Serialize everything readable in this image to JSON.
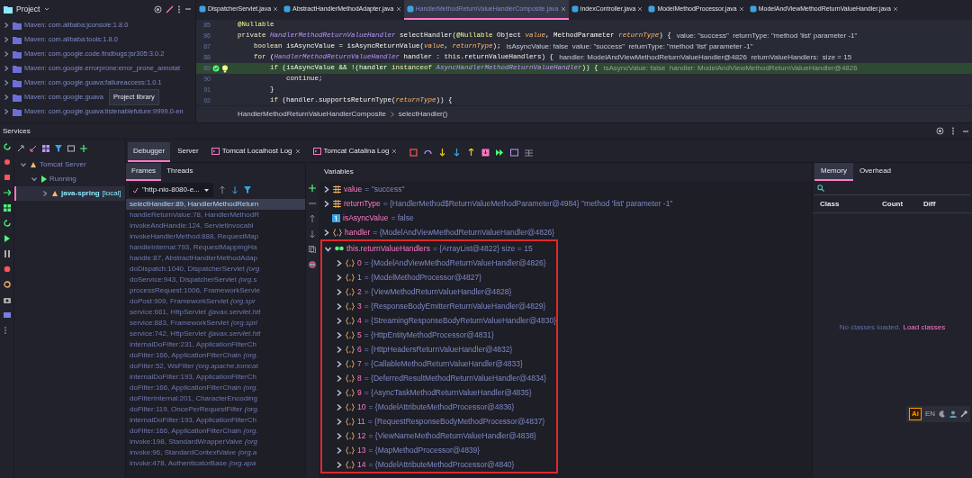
{
  "project": {
    "title": "Project",
    "items": [
      {
        "label": "Maven: com.alibaba:jconsole:1.8.0",
        "expanded": false
      },
      {
        "label": "Maven: com.alibaba:tools:1.8.0",
        "expanded": false
      },
      {
        "label": "Maven: com.google.code.findbugs:jsr305:3.0.2",
        "expanded": false
      },
      {
        "label": "Maven: com.google.errorprone:error_prone_annotat",
        "expanded": false
      },
      {
        "label": "Maven: com.google.guava:failureaccess:1.0.1",
        "expanded": false
      },
      {
        "label": "Maven: com.google.guava",
        "expanded": false,
        "tooltip": "Project library"
      },
      {
        "label": "Maven: com.google.guava:listenablefuture:9999.0-en",
        "expanded": false
      }
    ]
  },
  "editor": {
    "tabs": [
      {
        "label": "DispatcherServlet.java",
        "selected": false
      },
      {
        "label": "AbstractHandlerMethodAdapter.java",
        "selected": false
      },
      {
        "label": "HandlerMethodReturnValueHandlerComposite.java",
        "selected": true
      },
      {
        "label": "IndexController.java",
        "selected": false
      },
      {
        "label": "ModelMethodProcessor.java",
        "selected": false
      },
      {
        "label": "ModelAndViewMethodReturnValueHandler.java",
        "selected": false
      }
    ],
    "lines": [
      {
        "number": "85",
        "current": false,
        "breakpoint": false,
        "tokens": [
          {
            "kind": "annotation",
            "text": "@Nullable"
          }
        ]
      },
      {
        "number": "86",
        "current": false,
        "breakpoint": false,
        "tokens": [
          {
            "kind": "keyword",
            "text": "private "
          },
          {
            "kind": "type",
            "text": "HandlerMethodReturnValueHandler"
          },
          {
            "kind": "plain",
            "text": " selectHandler("
          },
          {
            "kind": "annotation",
            "text": "@Nullable"
          },
          {
            "kind": "plain",
            "text": " Object "
          },
          {
            "kind": "param",
            "text": "value"
          },
          {
            "kind": "plain",
            "text": ", MethodParameter "
          },
          {
            "kind": "param",
            "text": "returnType"
          },
          {
            "kind": "plain",
            "text": ") {"
          }
        ],
        "hint": "value: \"success\"  returnType: \"method 'list' parameter -1\""
      },
      {
        "number": "87",
        "current": false,
        "breakpoint": false,
        "tokens": [
          {
            "kind": "keyword",
            "text": "    boolean "
          },
          {
            "kind": "plain",
            "text": "isAsyncValue = isAsyncReturnValue("
          },
          {
            "kind": "param",
            "text": "value"
          },
          {
            "kind": "plain",
            "text": ", "
          },
          {
            "kind": "param",
            "text": "returnType"
          },
          {
            "kind": "plain",
            "text": ");"
          }
        ],
        "hint": "isAsyncValue: false  value: \"success\"  returnType: \"method 'list' parameter -1\""
      },
      {
        "number": "88",
        "current": false,
        "breakpoint": false,
        "tokens": [
          {
            "kind": "keyword",
            "text": "    for "
          },
          {
            "kind": "plain",
            "text": "("
          },
          {
            "kind": "type",
            "text": "HandlerMethodReturnValueHandler"
          },
          {
            "kind": "plain",
            "text": " handler : "
          },
          {
            "kind": "keyword",
            "text": "this"
          },
          {
            "kind": "plain",
            "text": ".returnValueHandlers) {"
          }
        ],
        "hint": "handler: ModelAndViewMethodReturnValueHandler@4826  returnValueHandlers:  size = 15"
      },
      {
        "number": "89",
        "current": true,
        "breakpoint": true,
        "tokens": [
          {
            "kind": "keyword",
            "text": "        if "
          },
          {
            "kind": "plain",
            "text": "(isAsyncValue && !(handler "
          },
          {
            "kind": "keyword",
            "text": "instanceof "
          },
          {
            "kind": "type",
            "text": "AsyncHandlerMethodReturnValueHandler"
          },
          {
            "kind": "plain",
            "text": ")) {"
          }
        ],
        "hint": "isAsyncValue: false  handler: ModelAndViewMethodReturnValueHandler@4826"
      },
      {
        "number": "90",
        "current": false,
        "breakpoint": false,
        "tokens": [
          {
            "kind": "keyword",
            "text": "            continue"
          },
          {
            "kind": "plain",
            "text": ";"
          }
        ]
      },
      {
        "number": "91",
        "current": false,
        "breakpoint": false,
        "tokens": [
          {
            "kind": "plain",
            "text": "        }"
          }
        ]
      },
      {
        "number": "92",
        "current": false,
        "breakpoint": false,
        "tokens": [
          {
            "kind": "keyword",
            "text": "        if "
          },
          {
            "kind": "plain",
            "text": "(handler.supportsReturnType("
          },
          {
            "kind": "param",
            "text": "returnType"
          },
          {
            "kind": "plain",
            "text": ")) {"
          }
        ]
      }
    ],
    "breadcrumb": [
      "HandlerMethodReturnValueHandlerComposite",
      "selectHandler()"
    ]
  },
  "services": {
    "title": "Services",
    "tree": [
      {
        "label": "Tomcat Server",
        "expanded": true,
        "selected": false,
        "children": [
          {
            "label": "Running",
            "expanded": true,
            "selected": false,
            "children": [
              {
                "label": "java-spring",
                "suffix": "[local]",
                "expanded": false,
                "selected": true
              }
            ]
          }
        ]
      }
    ]
  },
  "debugger": {
    "tabs": [
      {
        "label": "Debugger",
        "kind": "plain",
        "selected": true
      },
      {
        "label": "Server",
        "kind": "plain",
        "selected": false
      },
      {
        "label": "Tomcat Localhost Log",
        "kind": "log",
        "selected": false
      },
      {
        "label": "Tomcat Catalina Log",
        "kind": "log",
        "selected": false
      }
    ],
    "frame_tabs": [
      {
        "label": "Frames",
        "selected": true
      },
      {
        "label": "Threads",
        "selected": false
      }
    ],
    "thread": "\"http-nio-8080-e...",
    "frames": [
      {
        "text": "selectHandler:89, HandlerMethodReturn",
        "selected": true
      },
      {
        "text": "handleReturnValue:78, HandlerMethodR",
        "selected": false
      },
      {
        "text": "invokeAndHandle:124, ServletInvocabl",
        "selected": false
      },
      {
        "text": "invokeHandlerMethod:888, RequestMap",
        "selected": false
      },
      {
        "text": "handleInternal:793, RequestMappingHa",
        "selected": false
      },
      {
        "text": "handle:87, AbstractHandlerMethodAdap",
        "selected": false
      },
      {
        "text": "doDispatch:1040, DispatcherServlet *(org*",
        "selected": false
      },
      {
        "text": "doService:943, DispatcherServlet *(org.s*",
        "selected": false
      },
      {
        "text": "processRequest:1006, FrameworkServle",
        "selected": false
      },
      {
        "text": "doPost:909, FrameworkServlet *(org.spr*",
        "selected": false
      },
      {
        "text": "service:661, HttpServlet *(javax.servlet.htt*",
        "selected": false
      },
      {
        "text": "service:883, FrameworkServlet *(org.spri*",
        "selected": false
      },
      {
        "text": "service:742, HttpServlet *(javax.servlet.htt*",
        "selected": false
      },
      {
        "text": "internalDoFilter:231, ApplicationFilterCh",
        "selected": false
      },
      {
        "text": "doFilter:166, ApplicationFilterChain *(org.*",
        "selected": false
      },
      {
        "text": "doFilter:52, WsFilter *(org.apache.tomcat*",
        "selected": false
      },
      {
        "text": "internalDoFilter:193, ApplicationFilterCh",
        "selected": false
      },
      {
        "text": "doFilter:166, ApplicationFilterChain *(org.*",
        "selected": false
      },
      {
        "text": "doFilterInternal:201, CharacterEncoding",
        "selected": false
      },
      {
        "text": "doFilter:119, OncePerRequestFilter *(org.*",
        "selected": false
      },
      {
        "text": "internalDoFilter:193, ApplicationFilterCh",
        "selected": false
      },
      {
        "text": "doFilter:166, ApplicationFilterChain *(org.*",
        "selected": false
      },
      {
        "text": "invoke:198, StandardWrapperValve *(org*",
        "selected": false
      },
      {
        "text": "invoke:96, StandardContextValve *(org.a*",
        "selected": false
      },
      {
        "text": "invoke:478, AuthenticatorBase *(org.apa*",
        "selected": false
      }
    ],
    "variables_title": "Variables",
    "variables": [
      {
        "kind": "field",
        "name": "value",
        "value": "= \"success\"",
        "expanded": false,
        "highlighted": false
      },
      {
        "kind": "field",
        "name": "returnType",
        "value": "= {HandlerMethod$ReturnValueMethodParameter@4984} \"method 'list' parameter -1\"",
        "expanded": false,
        "highlighted": false
      },
      {
        "kind": "primitive",
        "name": "isAsyncValue",
        "value": "= false",
        "highlighted": false
      },
      {
        "kind": "object",
        "name": "handler",
        "value": "= {ModelAndViewMethodReturnValueHandler@4826}",
        "expanded": false,
        "highlighted": false
      },
      {
        "kind": "watch",
        "name": "this.returnValueHandlers",
        "value": "= {ArrayList@4822}  size = 15",
        "expanded": true,
        "highlighted": true,
        "children": [
          {
            "kind": "object",
            "name": "0",
            "value": "= {ModelAndViewMethodReturnValueHandler@4826}",
            "expanded": false
          },
          {
            "kind": "object",
            "name": "1",
            "value": "= {ModelMethodProcessor@4827}",
            "expanded": false
          },
          {
            "kind": "object",
            "name": "2",
            "value": "= {ViewMethodReturnValueHandler@4828}",
            "expanded": false
          },
          {
            "kind": "object",
            "name": "3",
            "value": "= {ResponseBodyEmitterReturnValueHandler@4829}",
            "expanded": false
          },
          {
            "kind": "object",
            "name": "4",
            "value": "= {StreamingResponseBodyReturnValueHandler@4830}",
            "expanded": false
          },
          {
            "kind": "object",
            "name": "5",
            "value": "= {HttpEntityMethodProcessor@4831}",
            "expanded": false
          },
          {
            "kind": "object",
            "name": "6",
            "value": "= {HttpHeadersReturnValueHandler@4832}",
            "expanded": false
          },
          {
            "kind": "object",
            "name": "7",
            "value": "= {CallableMethodReturnValueHandler@4833}",
            "expanded": false
          },
          {
            "kind": "object",
            "name": "8",
            "value": "= {DeferredResultMethodReturnValueHandler@4834}",
            "expanded": false
          },
          {
            "kind": "object",
            "name": "9",
            "value": "= {AsyncTaskMethodReturnValueHandler@4835}",
            "expanded": false
          },
          {
            "kind": "object",
            "name": "10",
            "value": "= {ModelAttributeMethodProcessor@4836}",
            "expanded": false
          },
          {
            "kind": "object",
            "name": "11",
            "value": "= {RequestResponseBodyMethodProcessor@4837}",
            "expanded": false
          },
          {
            "kind": "object",
            "name": "12",
            "value": "= {ViewNameMethodReturnValueHandler@4838}",
            "expanded": false
          },
          {
            "kind": "object",
            "name": "13",
            "value": "= {MapMethodProcessor@4839}",
            "expanded": false
          },
          {
            "kind": "object",
            "name": "14",
            "value": "= {ModelAttributeMethodProcessor@4840}",
            "expanded": false
          }
        ]
      }
    ]
  },
  "memory": {
    "tabs": [
      {
        "label": "Memory",
        "selected": true
      },
      {
        "label": "Overhead",
        "selected": false
      }
    ],
    "columns": [
      "Class",
      "Count",
      "Diff"
    ],
    "empty_text": "No classes loaded.",
    "empty_link": "Load classes"
  },
  "tray": {
    "app_badge": "Ai",
    "language": "EN"
  }
}
